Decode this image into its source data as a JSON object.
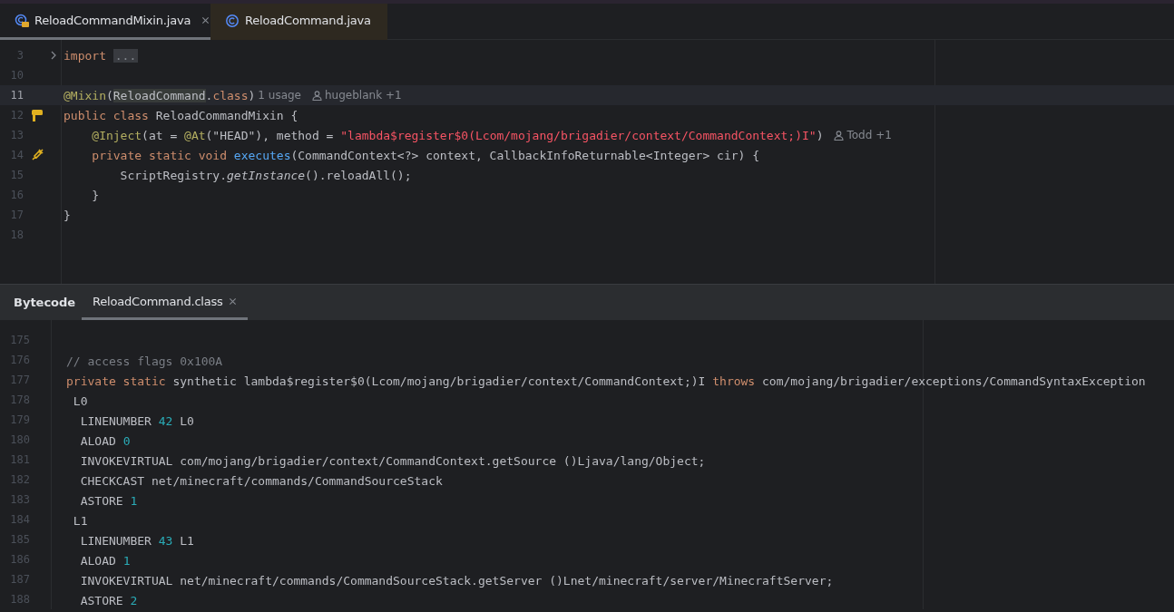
{
  "editor_tabs": [
    {
      "label": "ReloadCommandMixin.java",
      "kind": "mixin",
      "selected": true,
      "closable": true
    },
    {
      "label": "ReloadCommand.java",
      "kind": "class",
      "selected": false,
      "closable": false
    }
  ],
  "editor": {
    "lines": [
      {
        "number": "3",
        "folded": true,
        "tokens": [
          {
            "kind": "keyword",
            "text": "import "
          },
          {
            "kind": "folded",
            "text": "..."
          }
        ]
      },
      {
        "number": "10"
      },
      {
        "number": "11",
        "current": true,
        "tokens": [
          {
            "kind": "annotation",
            "text": "@Mixin"
          },
          {
            "kind": "plain",
            "text": "("
          },
          {
            "kind": "highlight",
            "text": "ReloadCommand"
          },
          {
            "kind": "plain",
            "text": "."
          },
          {
            "kind": "keyword",
            "text": "class"
          },
          {
            "kind": "plain",
            "text": ")"
          }
        ],
        "hints": [
          {
            "kind": "usages",
            "text": "1 usage"
          },
          {
            "kind": "author",
            "text": "hugeblank +1"
          }
        ]
      },
      {
        "number": "12",
        "kind": "mixin",
        "tokens": [
          {
            "kind": "keyword",
            "text": "public class "
          },
          {
            "kind": "plain",
            "text": "ReloadCommandMixin {"
          }
        ]
      },
      {
        "number": "13",
        "tokens": [
          {
            "kind": "annotation",
            "text": "    @Inject"
          },
          {
            "kind": "plain",
            "text": "(at = "
          },
          {
            "kind": "annotation",
            "text": "@At"
          },
          {
            "kind": "plain",
            "text": "(\"HEAD\"), method = "
          },
          {
            "kind": "error",
            "text": "\"lambda$register$0(Lcom/mojang/brigadier/context/CommandContext;)I\""
          },
          {
            "kind": "plain",
            "text": ")"
          }
        ],
        "hints": [
          {
            "kind": "author",
            "text": "Todd +1"
          }
        ]
      },
      {
        "number": "14",
        "kind": "injector",
        "tokens": [
          {
            "kind": "keyword",
            "text": "    private static void "
          },
          {
            "kind": "function",
            "text": "executes"
          },
          {
            "kind": "plain",
            "text": "(CommandContext<?> context, CallbackInfoReturnable<Integer> cir) {"
          }
        ]
      },
      {
        "number": "15",
        "tokens": [
          {
            "kind": "plain",
            "text": "        ScriptRegistry."
          },
          {
            "kind": "italic",
            "text": "getInstance"
          },
          {
            "kind": "plain",
            "text": "().reloadAll();"
          }
        ]
      },
      {
        "number": "16",
        "tokens": [
          {
            "kind": "plain",
            "text": "    }"
          }
        ]
      },
      {
        "number": "17",
        "tokens": [
          {
            "kind": "plain",
            "text": "}"
          }
        ]
      },
      {
        "number": "18"
      }
    ]
  },
  "bytecode_panel": {
    "title": "Bytecode",
    "tabs": [
      {
        "label": "ReloadCommand.class",
        "selected": true,
        "closable": true
      }
    ],
    "lines": [
      {
        "number": "175"
      },
      {
        "number": "176",
        "tokens": [
          {
            "kind": "comment",
            "text": "// access flags 0x100A"
          }
        ]
      },
      {
        "number": "177",
        "tokens": [
          {
            "kind": "keyword",
            "text": "private static "
          },
          {
            "kind": "plain",
            "text": "synthetic lambda$register$0(Lcom/mojang/brigadier/context/CommandContext;)I "
          },
          {
            "kind": "keyword",
            "text": "throws"
          },
          {
            "kind": "plain",
            "text": " com/mojang/brigadier/exceptions/CommandSyntaxException"
          }
        ]
      },
      {
        "number": "178",
        "tokens": [
          {
            "kind": "plain",
            "text": " L0"
          }
        ]
      },
      {
        "number": "179",
        "tokens": [
          {
            "kind": "plain",
            "text": "  LINENUMBER "
          },
          {
            "kind": "number",
            "text": "42"
          },
          {
            "kind": "plain",
            "text": " L0"
          }
        ]
      },
      {
        "number": "180",
        "tokens": [
          {
            "kind": "plain",
            "text": "  ALOAD "
          },
          {
            "kind": "number",
            "text": "0"
          }
        ]
      },
      {
        "number": "181",
        "tokens": [
          {
            "kind": "plain",
            "text": "  INVOKEVIRTUAL com/mojang/brigadier/context/CommandContext.getSource ()Ljava/lang/Object;"
          }
        ]
      },
      {
        "number": "182",
        "tokens": [
          {
            "kind": "plain",
            "text": "  CHECKCAST net/minecraft/commands/CommandSourceStack"
          }
        ]
      },
      {
        "number": "183",
        "tokens": [
          {
            "kind": "plain",
            "text": "  ASTORE "
          },
          {
            "kind": "number",
            "text": "1"
          }
        ]
      },
      {
        "number": "184",
        "tokens": [
          {
            "kind": "plain",
            "text": " L1"
          }
        ]
      },
      {
        "number": "185",
        "tokens": [
          {
            "kind": "plain",
            "text": "  LINENUMBER "
          },
          {
            "kind": "number",
            "text": "43"
          },
          {
            "kind": "plain",
            "text": " L1"
          }
        ]
      },
      {
        "number": "186",
        "tokens": [
          {
            "kind": "plain",
            "text": "  ALOAD "
          },
          {
            "kind": "number",
            "text": "1"
          }
        ]
      },
      {
        "number": "187",
        "tokens": [
          {
            "kind": "plain",
            "text": "  INVOKEVIRTUAL net/minecraft/commands/CommandSourceStack.getServer ()Lnet/minecraft/server/MinecraftServer;"
          }
        ]
      },
      {
        "number": "188",
        "tokens": [
          {
            "kind": "plain",
            "text": "  ASTORE "
          },
          {
            "kind": "number",
            "text": "2"
          }
        ]
      }
    ]
  }
}
